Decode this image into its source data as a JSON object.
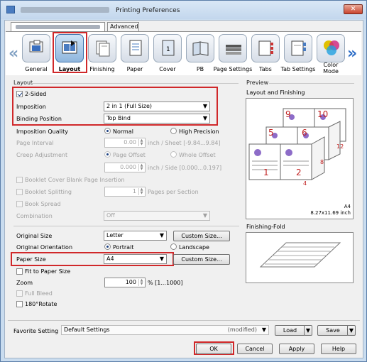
{
  "window": {
    "title": "Printing Preferences",
    "close": "✕"
  },
  "tabs": {
    "advanced": "Advanced"
  },
  "ribbon": [
    {
      "label": "General",
      "icon": "general-icon"
    },
    {
      "label": "Layout",
      "icon": "layout-icon"
    },
    {
      "label": "Finishing",
      "icon": "finishing-icon"
    },
    {
      "label": "Paper",
      "icon": "paper-icon"
    },
    {
      "label": "Cover",
      "icon": "cover-icon"
    },
    {
      "label": "PB",
      "icon": "perfect-binding-icon"
    },
    {
      "label": "Page Settings",
      "icon": "page-settings-icon"
    },
    {
      "label": "Tabs",
      "icon": "tabs-icon"
    },
    {
      "label": "Tab Settings",
      "icon": "tab-settings-icon"
    },
    {
      "label": "Color",
      "label2": "Mode",
      "icon": "color-mode-icon"
    }
  ],
  "layout": {
    "group": "Layout",
    "two_sided": "2-Sided",
    "imposition_label": "Imposition",
    "imposition_value": "2 in 1 (Full Size)",
    "binding_label": "Binding Position",
    "binding_value": "Top Bind",
    "quality_label": "Imposition Quality",
    "quality_normal": "Normal",
    "quality_high": "High Precision",
    "page_interval_label": "Page Interval",
    "page_interval_value": "0.00",
    "page_interval_unit": "inch / Sheet [-9.84...9.84]",
    "creep_label": "Creep Adjustment",
    "creep_offset": "Page Offset",
    "creep_whole": "Whole Offset",
    "creep_value": "0.000",
    "creep_unit": "inch / Side [0.000...0.197]",
    "booklet_blank": "Booklet Cover Blank Page Insertion",
    "booklet_split": "Booklet Splitting",
    "booklet_split_value": "1",
    "booklet_split_unit": "Pages per Section",
    "book_spread": "Book Spread",
    "combination_label": "Combination",
    "combination_value": "Off",
    "original_size_label": "Original Size",
    "original_size_value": "Letter",
    "custom_size": "Custom Size...",
    "orientation_label": "Original Orientation",
    "portrait": "Portrait",
    "landscape": "Landscape",
    "paper_size_label": "Paper Size",
    "paper_size_value": "A4",
    "fit": "Fit to Paper Size",
    "zoom_label": "Zoom",
    "zoom_value": "100",
    "zoom_unit": "% [1...1000]",
    "full_bleed": "Full Bleed",
    "rotate": "180°Rotate"
  },
  "preview": {
    "group": "Preview",
    "layout_finishing": "Layout and Finishing",
    "paper": "A4",
    "paper_size": "8.27x11.69 inch",
    "finishing_fold": "Finishing-Fold",
    "page_numbers": [
      "9",
      "10",
      "5",
      "6",
      "1",
      "2",
      "8",
      "12",
      "4"
    ]
  },
  "footer": {
    "favorite_label": "Favorite Setting",
    "favorite_value": "Default Settings",
    "modified": "(modified)",
    "load": "Load",
    "save": "Save",
    "ok": "OK",
    "cancel": "Cancel",
    "apply": "Apply",
    "help": "Help"
  }
}
